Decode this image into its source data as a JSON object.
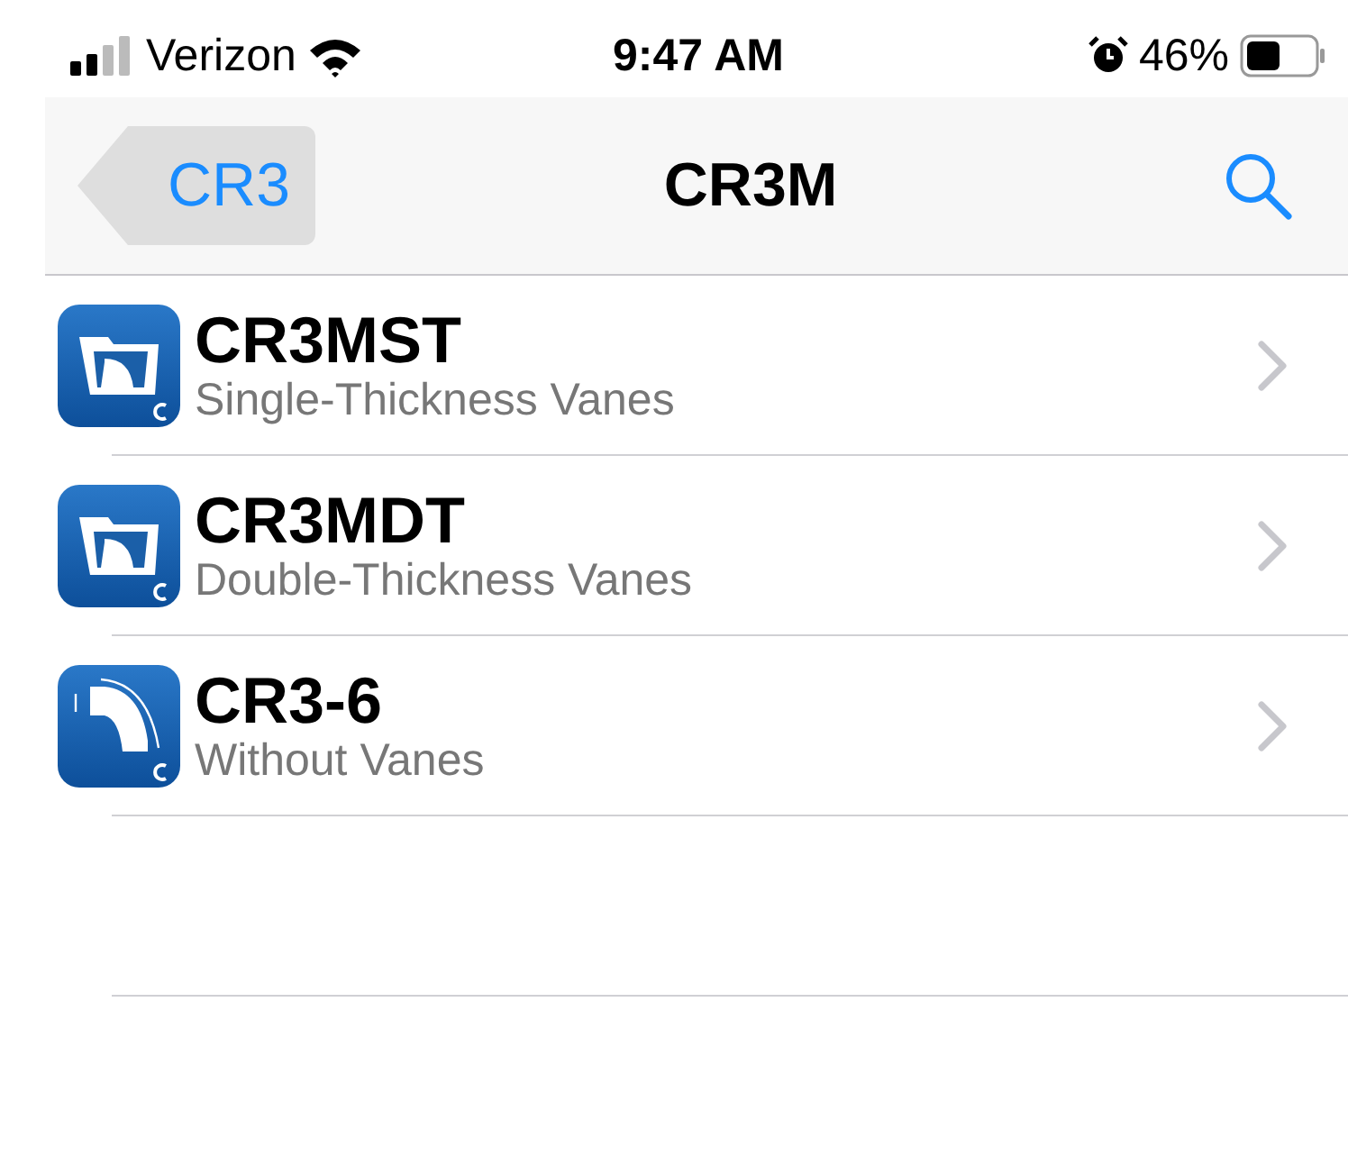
{
  "status_bar": {
    "carrier": "Verizon",
    "time": "9:47 AM",
    "battery": "46%"
  },
  "nav": {
    "back": "CR3",
    "title": "CR3M"
  },
  "rows": [
    {
      "title": "CR3MST",
      "subtitle": "Single-Thickness Vanes",
      "kind": "vanes"
    },
    {
      "title": "CR3MDT",
      "subtitle": "Double-Thickness Vanes",
      "kind": "vanes"
    },
    {
      "title": "CR3-6",
      "subtitle": "Without Vanes",
      "kind": "elbow"
    }
  ]
}
